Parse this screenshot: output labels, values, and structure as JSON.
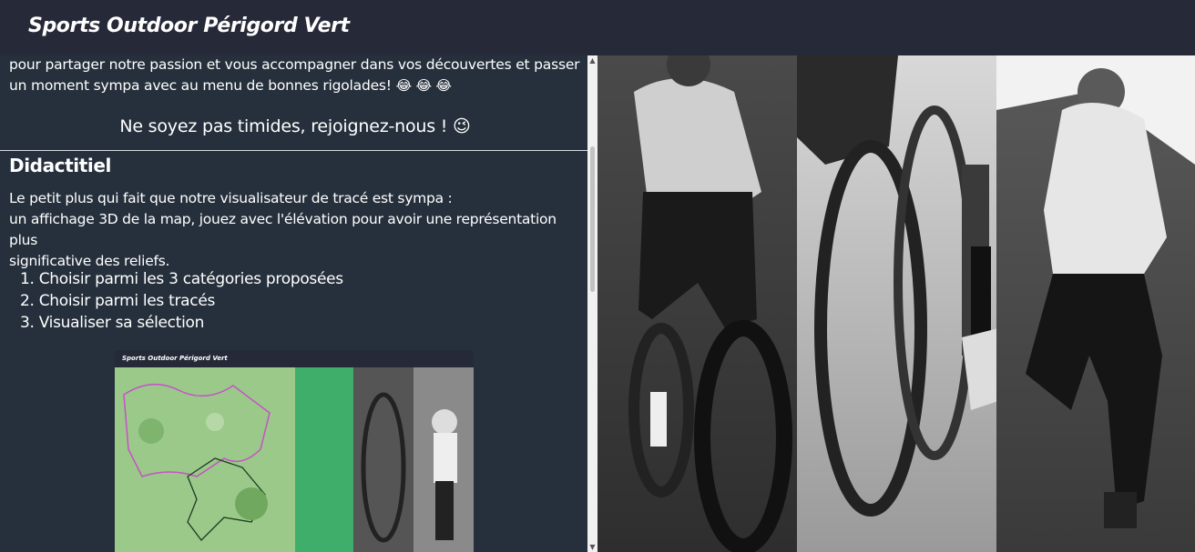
{
  "app": {
    "title": "Sports Outdoor Périgord Vert"
  },
  "intro": {
    "line1": "pour partager notre passion et vous accompagner dans vos découvertes et passer",
    "line2": "un moment sympa avec au menu de bonnes rigolades!",
    "emojis": "😂 😂 😂"
  },
  "invite": "Ne soyez pas timides, rejoignez-nous ! 😉",
  "didacticiel": {
    "title": "Didactitiel",
    "desc_line1": "Le petit plus qui fait que notre visualisateur de tracé est sympa :",
    "desc_line2": "un affichage 3D de la map, jouez avec l'élévation pour avoir une représentation plus",
    "desc_line3": "significative des reliefs.",
    "steps": [
      "1. Choisir parmi les 3 catégories proposées",
      "2. Choisir parmi les tracés",
      "3. Visualiser sa sélection"
    ]
  },
  "preview": {
    "title": "Sports Outdoor Périgord Vert"
  },
  "scrollbar": {
    "up_icon": "chevron-up-icon",
    "down_icon": "chevron-down-icon"
  },
  "colors": {
    "header_bg": "#262a38",
    "panel_bg": "#26303c",
    "preview_green": "#3fae6a"
  }
}
